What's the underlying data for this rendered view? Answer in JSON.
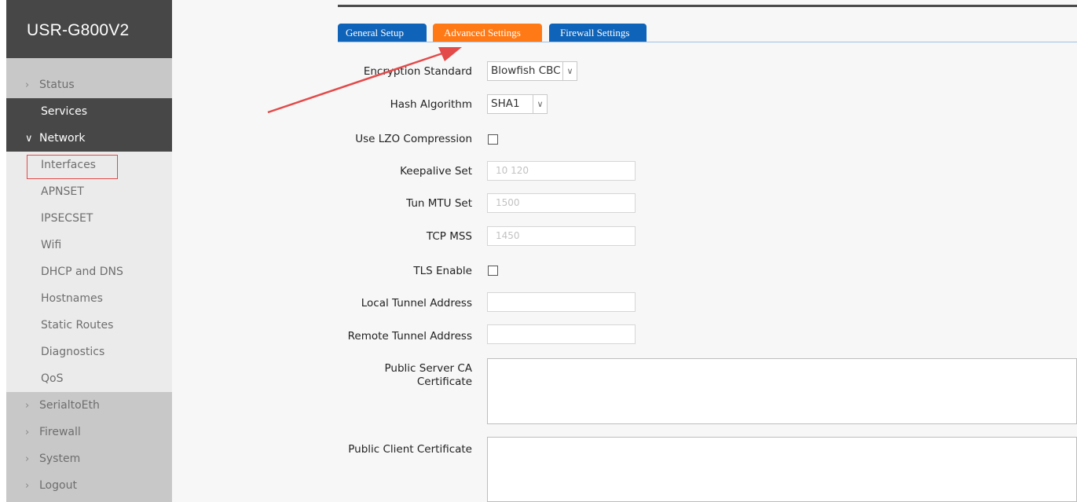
{
  "sidebar": {
    "brand": "USR-G800V2",
    "items": [
      {
        "label": "Status"
      },
      {
        "label": "Services"
      },
      {
        "label": "Network"
      }
    ],
    "network_sub": [
      {
        "label": "Interfaces"
      },
      {
        "label": "APNSET"
      },
      {
        "label": "IPSECSET"
      },
      {
        "label": "Wifi"
      },
      {
        "label": "DHCP and DNS"
      },
      {
        "label": "Hostnames"
      },
      {
        "label": "Static Routes"
      },
      {
        "label": "Diagnostics"
      },
      {
        "label": "QoS"
      }
    ],
    "bottom_items": [
      {
        "label": "SerialtoEth"
      },
      {
        "label": "Firewall"
      },
      {
        "label": "System"
      },
      {
        "label": "Logout"
      }
    ]
  },
  "tabs": [
    {
      "label": "General Setup"
    },
    {
      "label": "Advanced Settings"
    },
    {
      "label": "Firewall Settings"
    }
  ],
  "form": {
    "encryption_label": "Encryption Standard",
    "encryption_value": "Blowfish CBC",
    "hash_label": "Hash Algorithm",
    "hash_value": "SHA1",
    "lzo_label": "Use LZO Compression",
    "keepalive_label": "Keepalive Set",
    "keepalive_placeholder": "10 120",
    "tunmtu_label": "Tun MTU Set",
    "tunmtu_placeholder": "1500",
    "tcpmss_label": "TCP MSS",
    "tcpmss_placeholder": "1450",
    "tls_label": "TLS Enable",
    "local_tunnel_label": "Local Tunnel Address",
    "remote_tunnel_label": "Remote Tunnel Address",
    "server_ca_label_1": "Public Server CA",
    "server_ca_label_2": "Certificate",
    "client_cert_label": "Public Client Certificate"
  },
  "colors": {
    "tab_blue": "#0f63b8",
    "tab_orange": "#ff7a16",
    "annotation_red": "#e34a4a"
  }
}
